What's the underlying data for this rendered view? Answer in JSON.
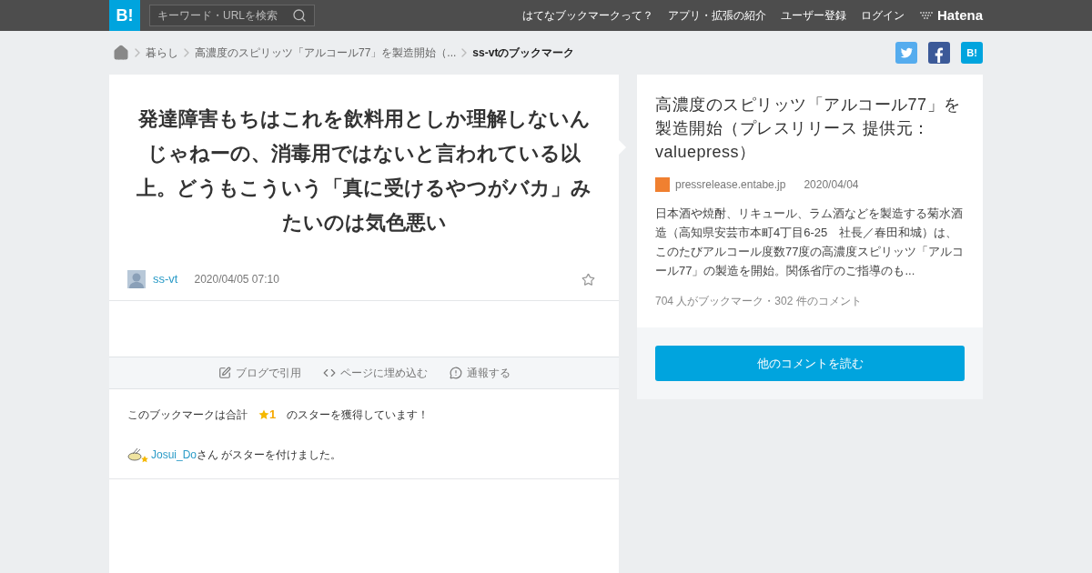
{
  "header": {
    "logo": "B!",
    "search": {
      "placeholder": "キーワード・URLを検索"
    },
    "nav": [
      "はてなブックマークって？",
      "アプリ・拡張の紹介",
      "ユーザー登録",
      "ログイン"
    ],
    "brand": "Hatena"
  },
  "breadcrumb": {
    "items": [
      "暮らし",
      "高濃度のスピリッツ「アルコール77」を製造開始（..."
    ],
    "current": "ss-vtのブックマーク"
  },
  "share": {
    "bookmark_label": "B!"
  },
  "bookmark": {
    "comment": "発達障害もちはこれを飲料用としか理解しないんじゃねーの、消毒用ではないと言われている以上。どうもこういう「真に受けるやつがバカ」みたいのは気色悪い",
    "user": "ss-vt",
    "time": "2020/04/05 07:10",
    "actions": [
      "ブログで引用",
      "ページに埋め込む",
      "通報する"
    ],
    "stars": {
      "before": "このブックマークは合計",
      "count": "1",
      "after": "のスターを獲得しています！"
    },
    "star_givers": [
      {
        "user": "Josui_Do",
        "text": "さん がスターを付けました。"
      }
    ]
  },
  "entry": {
    "title": "高濃度のスピリッツ「アルコール77」を製造開始（プレスリリース 提供元：valuepress）",
    "site": "pressrelease.entabe.jp",
    "date": "2020/04/04",
    "summary": "日本酒や焼酎、リキュール、ラム酒などを製造する菊水酒造（高知県安芸市本町4丁目6-25　社長／春田和城）は、このたびアルコール度数77度の高濃度スピリッツ「アルコール77」の製造を開始。関係省庁のご指導のも...",
    "stats": "704 人がブックマーク・302 件のコメント",
    "button": "他のコメントを読む"
  }
}
